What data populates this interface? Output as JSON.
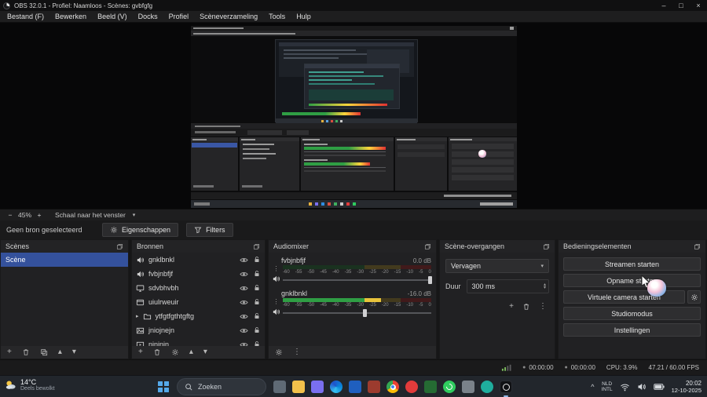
{
  "window": {
    "title": "OBS 32.0.1 - Profiel: Naamloos - Scènes: gvbfgfg",
    "minimize": "–",
    "maximize": "□",
    "close": "×"
  },
  "menu": {
    "items": [
      "Bestand (F)",
      "Bewerken",
      "Beeld (V)",
      "Docks",
      "Profiel",
      "Scèneverzameling",
      "Tools",
      "Hulp"
    ]
  },
  "preview": {
    "zoom_out": "−",
    "zoom_level": "45%",
    "zoom_in": "+",
    "scale_mode": "Schaal naar het venster",
    "dropdown": "▾"
  },
  "source_toolbar": {
    "no_source": "Geen bron geselecteerd",
    "properties": "Eigenschappen",
    "filters": "Filters"
  },
  "scenes": {
    "title": "Scènes",
    "items": [
      {
        "name": "Scène"
      }
    ]
  },
  "sources": {
    "title": "Bronnen",
    "items": [
      {
        "name": "gnklbnkl"
      },
      {
        "name": "fvbjnbfjf"
      },
      {
        "name": "sdvbhvbh"
      },
      {
        "name": "uiulrweuir"
      },
      {
        "name": "ytfgtfgthtgftg"
      },
      {
        "name": "jniojnejn"
      },
      {
        "name": "njnjnjn"
      }
    ]
  },
  "mixer": {
    "title": "Audiomixer",
    "scale": [
      "-60",
      "-55",
      "-50",
      "-45",
      "-40",
      "-35",
      "-30",
      "-25",
      "-20",
      "-15",
      "-10",
      "-5",
      "0"
    ],
    "channels": [
      {
        "name": "fvbjnbfjf",
        "db": "0.0 dB",
        "level_pct": 0,
        "slider_pct": 98
      },
      {
        "name": "gnklbnkl",
        "db": "-16.0 dB",
        "level_pct": 66,
        "slider_pct": 54
      }
    ]
  },
  "transitions": {
    "title": "Scène-overgangen",
    "selected": "Vervagen",
    "duration_label": "Duur",
    "duration": "300 ms"
  },
  "controls": {
    "title": "Bedieningselementen",
    "stream": "Streamen starten",
    "record": "Opname starten",
    "vcam": "Virtuele camera starten",
    "studio": "Studiomodus",
    "settings": "Instellingen"
  },
  "statusbar": {
    "dot": "●",
    "rec_time": "00:00:00",
    "stream_time": "00:00:00",
    "cpu": "CPU: 3.9%",
    "fps": "47.21 / 60.00 FPS"
  },
  "taskbar": {
    "weather_temp": "14°C",
    "weather_desc": "Deels bewolkt",
    "search": "Zoeken",
    "tray_caret": "^",
    "lang1": "NLD",
    "lang2": "INTL",
    "time": "20:02",
    "date": "12-10-2025"
  },
  "glyphs": {
    "kebab": "⋮",
    "up": "▴",
    "down": "▾",
    "plus": "+",
    "expand": "▸"
  },
  "colors": {
    "accent": "#34519c",
    "meter_green": "#2f9e44",
    "meter_yellow": "#e8c33b",
    "meter_red": "#e03131"
  }
}
